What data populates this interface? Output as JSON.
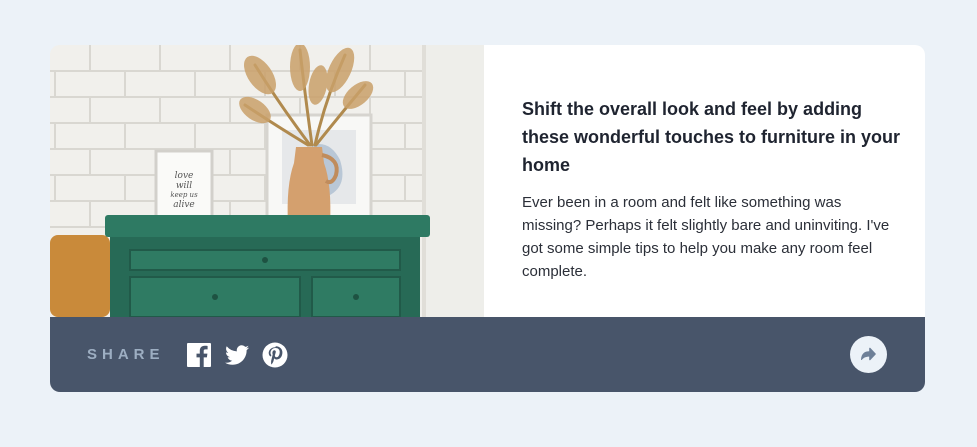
{
  "article": {
    "title": "Shift the overall look and feel by adding these wonderful touches to furniture in your home",
    "description": "Ever been in a room and felt like something was missing? Perhaps it felt slightly bare and uninviting. I've got some simple tips to help you make any room feel complete.",
    "image_frame_text": "love will keep us alive"
  },
  "share": {
    "label": "SHARE",
    "icons": [
      "facebook-icon",
      "twitter-icon",
      "pinterest-icon"
    ],
    "button_icon": "share-arrow-icon"
  },
  "colors": {
    "page_background": "#ECF2F8",
    "card_background": "#FFFFFF",
    "share_bar": "#48556A",
    "share_label": "#9DAEC2",
    "icon": "#FFFFFF"
  }
}
